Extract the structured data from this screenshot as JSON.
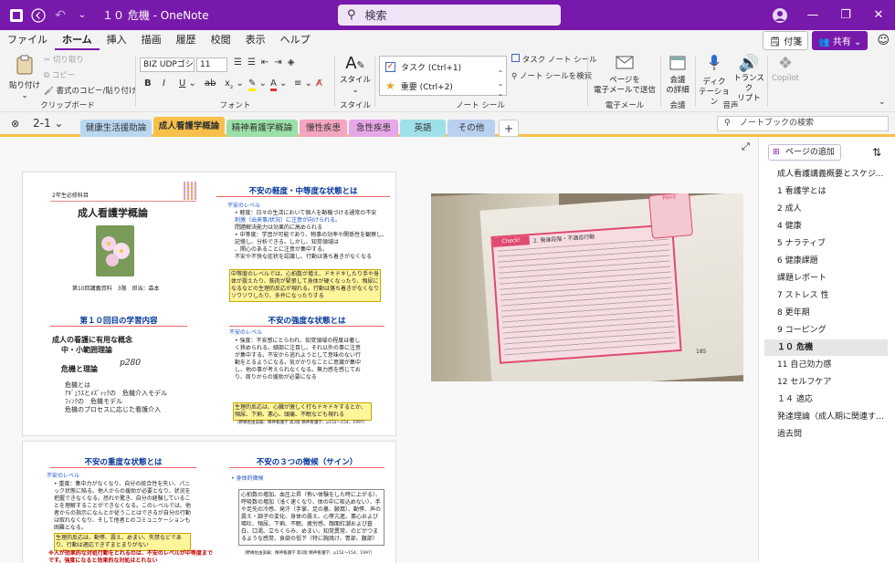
{
  "titlebar": {
    "doc_title": "１０ 危機 - OneNote",
    "search_placeholder": "検索"
  },
  "menu": {
    "items": [
      "ファイル",
      "ホーム",
      "挿入",
      "描画",
      "履歴",
      "校閲",
      "表示",
      "ヘルプ"
    ],
    "sticky_label": "付箋",
    "share_label": "共有"
  },
  "ribbon": {
    "clipboard": {
      "paste": "貼り付け",
      "cut": "切り取り",
      "copy": "コピー",
      "format_painter": "書式のコピー/貼り付け",
      "group": "クリップボード"
    },
    "font": {
      "family": "BIZ UDPゴシック",
      "size": "11",
      "group": "フォント"
    },
    "style": {
      "label": "スタイル",
      "group": "スタイル"
    },
    "tags": {
      "todo": "タスク (Ctrl+1)",
      "important": "重要 (Ctrl+2)",
      "task_tag": "タスク ノート シール",
      "find_tags": "ノート シールを検索",
      "group": "ノート シール"
    },
    "email": {
      "label_line1": "ページを",
      "label_line2": "電子メールで送信",
      "group": "電子メール"
    },
    "meeting": {
      "label_line1": "会議",
      "label_line2": "の詳細",
      "group": "会議"
    },
    "voice": {
      "dictate_line1": "ディク",
      "dictate_line2": "テーション",
      "transcribe_line1": "トランスク",
      "transcribe_line2": "リプト",
      "group": "音声"
    },
    "copilot": "Copilot"
  },
  "notebook": {
    "section_picker": "2-1",
    "search_placeholder": "ノートブックの検索",
    "tabs": [
      {
        "label": "健康生活援助論",
        "color": "#b9d7f0"
      },
      {
        "label": "成人看護学概論",
        "color": "#f6c04a"
      },
      {
        "label": "精神看護学概論",
        "color": "#9be0a8"
      },
      {
        "label": "慢性疾患",
        "color": "#f4a5c0"
      },
      {
        "label": "急性疾患",
        "color": "#e7a8e8"
      },
      {
        "label": "英語",
        "color": "#9fe0e8"
      },
      {
        "label": "その他",
        "color": "#b9d0f0"
      }
    ],
    "add_tab": "+"
  },
  "slides": {
    "s1": {
      "subject": "2年生必修科目",
      "title": "成人看護学概論",
      "session": "第10回講義資料",
      "period": "3限",
      "teacher": "担当：森本"
    },
    "s2": {
      "title": "不安の軽度・中等度な状態とは",
      "level": "不安のレベル",
      "b1": "軽度：日々の生活において個人を動機づける通常の不安",
      "b1b": "刺激（出来事/状況）に注意が向けられる。",
      "b1c": "問題解決能力は効果的に高められる",
      "b2": "中等度：学習が可能であり、物事の効率や関係性を観察し、記憶し、分析できる。しかし、知覚領域は",
      "b2b": "、関心のあることに注意が集中する。",
      "b2c": "不安や不快な症状を認識し、行動は落ち着きがなくなる",
      "box": "中等度のレベルでは、心拍数が増え、ドキドキしたり手や身体が震えたり、筋肉が緊張して身体が硬くなったり、頻尿になるなどの生理的反応が現れる。行動は落ち着きがなくなりソワソワしたり、多弁になったりする"
    },
    "s3": {
      "title": "第１０回目の学習内容",
      "line1": "成人の看護に有用な概念",
      "line2": "中・小範囲理論",
      "line3": "危機と理論",
      "hand": "p280",
      "l4": "危機とは",
      "l5": "ｱｷﾞｭﾗｽとﾒｽﾞｨｯｸの　危機介入モデル",
      "l6": "ﾌｨﾝｸの　危機モデル",
      "l7": "危機のプロセスに応じた看護介入"
    },
    "s4": {
      "title": "不安の強度な状態とは",
      "level": "不安のレベル",
      "b1": "強度：不安感にとらわれ、知覚領域の程度は著しく狭められる。細部に注目し、それ以外の事に注意が集中する。不安から逃れようとして意味のない行動をとるようになる。気がかりなことに意識が集中し、他の事が考えられなくなる。無力感を感じており、周りからの援助が必要になる",
      "box": "生理的反応は、心臓が激しく打ちドキドキするとか、頻尿、下痢、悪心、頭痛、不眠なども現れる",
      "src": "（野嶋佐由美編：精神看護学 第2版 精神看護学、p152～154、1997）"
    },
    "s5": {
      "title": "不安の重度な状態とは",
      "level": "不安のレベル",
      "b1": "重度：集中力がなくなり、自分の統合性を失い、パニック状態に陥る。他人からの援助が必要となり、状況を把握できなくなる。恐れや驚き、自分の経験していることを理解することができなくなる。このレベルでは、他者からの指示になんとか従うことはできるが自分の行動は取れなくなり、そして他者とのコミュニケーションも困難となる。",
      "box": "生理的反応は、動悸、震え、めまい、失禁などであり、行動は適応できずまとまりがない",
      "note": "※人が効果的な対処行動をとれるのは、不安のレベルが中等度までです。強度になると効果的な対処はとれない"
    },
    "s6": {
      "title": "不安の３つの徴候（サイン）",
      "sub": "身体的徴候",
      "list": "心拍数の増加、血圧上昇（怖い体験をした時に上がる）、呼吸数の増加（浅く速くなり、体の中に吸込めない）、手や足先の冷感、発汗（手掌、足の裏、腋窩）、動悸、声の震え・調子の変化、身体の震え、心悸亢進、悪心および嘔吐、頻尿、下痢、不眠、疲労感、顔面紅潮および蒼白、口渇、立ちくらみ、めまい、知覚異常、のどがつまるような感覚、食欲の低下（特に胸焼け、胃部、腹部）",
      "src": "（野嶋佐由美編：精神看護学 第2版 精神看護学、p152～154、1997）"
    }
  },
  "photo": {
    "label": "Check!",
    "heading": "2. 発達段階・不適応行動",
    "page_num": "185",
    "point": "Point"
  },
  "sidebar": {
    "add_page": "ページの追加",
    "pages": [
      {
        "label": "成人看護講義概要とスケジュー…",
        "selected": false
      },
      {
        "label": "1 看護学とは",
        "selected": false
      },
      {
        "label": "2 成人",
        "selected": false
      },
      {
        "label": "4 健康",
        "selected": false
      },
      {
        "label": "5 ナラティブ",
        "selected": false
      },
      {
        "label": "6 健康課題",
        "selected": false
      },
      {
        "label": "課題レポート",
        "selected": false
      },
      {
        "label": "7 ストレス 性",
        "selected": false
      },
      {
        "label": "8 更年期",
        "selected": false
      },
      {
        "label": "9 コーピング",
        "selected": false
      },
      {
        "label": "１０ 危機",
        "selected": true
      },
      {
        "label": "11 自己効力感",
        "selected": false
      },
      {
        "label": "12 セルフケア",
        "selected": false
      },
      {
        "label": "１４ 適応",
        "selected": false
      },
      {
        "label": "発達理論（成人期に関連する…",
        "selected": false
      },
      {
        "label": "過去問",
        "selected": false
      }
    ]
  },
  "colors": {
    "brand": "#7719aa",
    "active_tab": "#f6c04a",
    "selected_page": "#e6e6e6"
  }
}
